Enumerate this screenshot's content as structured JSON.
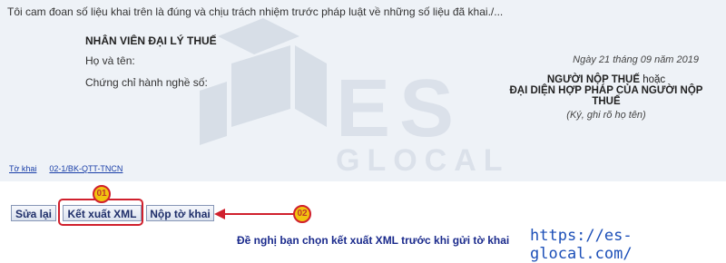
{
  "declaration": "Tôi cam đoan số liệu khai trên là đúng và chịu trách nhiệm trước pháp luật về những số liệu đã khai./...",
  "agent": {
    "title": "NHÂN VIÊN ĐẠI LÝ THUẾ",
    "name_label": "Họ và tên:",
    "cert_label": "Chứng chỉ hành nghề số:"
  },
  "taxpayer": {
    "date": "Ngày 21 tháng 09 năm 2019",
    "title_main": "NGƯỜI NỘP THUẾ",
    "title_or": " hoặc",
    "title_line2": "ĐẠI DIỆN HỢP PHÁP CỦA NGƯỜI NỘP",
    "title_line3": "THUẾ",
    "sign_note": "(Ký, ghi rõ họ tên)"
  },
  "breadcrumb": {
    "link1": "Tờ khai",
    "link2": "02-1/BK-QTT-TNCN"
  },
  "buttons": {
    "edit": "Sửa lại",
    "export_xml": "Kết xuất XML",
    "submit": "Nộp tờ khai"
  },
  "callouts": {
    "badge1": "01",
    "badge2": "02",
    "highlight_color": "#d0202d",
    "badge_fill": "#f1c40f"
  },
  "hint": "Đề nghị bạn chọn kết xuất XML trước khi gửi tờ khai",
  "website": "https://es-glocal.com/",
  "watermark_text": [
    "ES",
    "GLOCAL"
  ]
}
